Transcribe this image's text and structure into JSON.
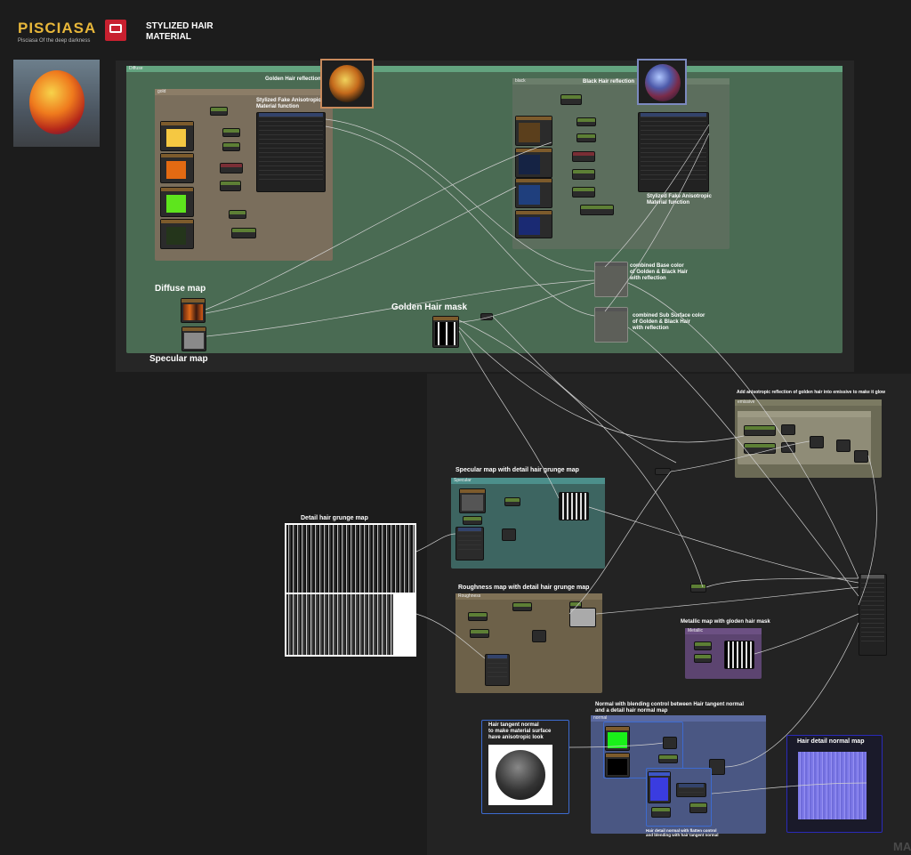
{
  "brand": {
    "logo_text": "PISCIASA",
    "tagline": "Pisciasa Of the deep darkness",
    "title_line1": "STYLIZED HAIR",
    "title_line2": "MATERIAL"
  },
  "frames": {
    "diffuse": "Diffuse",
    "golden_inner": "gold",
    "black_inner": "black",
    "specular_grunge": "Specular",
    "roughness_grunge": "Roughness",
    "metallic": "Metallic",
    "emissive": "emissive",
    "normal": "normal"
  },
  "labels": {
    "golden_reflection": "Golden Hair reflection",
    "black_reflection": "Black Hair reflection",
    "stylized_fn_1": "Stylized Fake Anisotropic",
    "stylized_fn_2": "Material function",
    "stylized_fn_b1": "Stylized Fake Anisotropic",
    "stylized_fn_b2": "Material function",
    "diffuse_map": "Diffuse map",
    "specular_map": "Specular map",
    "golden_mask": "Golden Hair mask",
    "combined_base_1": "combined Base color",
    "combined_base_2": "of Golden & Black Hair",
    "combined_base_3": "with reflection",
    "combined_sub_1": "combined Sub Surface color",
    "combined_sub_2": "of Golden & Black Hair",
    "combined_sub_3": "with reflection",
    "emissive_note": "Add anisotropic reflection of golden hair into emissive to make it glow",
    "specular_grunge": "Specular map with detail hair grunge map",
    "detail_grunge": "Detail hair grunge map",
    "roughness_grunge": "Roughness map with detail hair grunge map",
    "metallic_mask": "Metallic map with gloden hair mask",
    "normal_blend_1": "Normal with blending control between Hair tangent normal",
    "normal_blend_2": "and a detail hair normal map",
    "hair_tangent_1": "Hair tangent normal",
    "hair_tangent_2": "to make material surface",
    "hair_tangent_3": "have anisotropic look",
    "hair_detail_normal": "Hair detail normal map",
    "normal_flatten_1": "Hair detail normal with flatten control",
    "normal_flatten_2": "and blending with hair tangent normal",
    "watermark": "MA"
  },
  "colors": {
    "diffuse_frame": "#4a6b53",
    "golden_frame": "#6f6556",
    "black_frame": "#5a6d5b",
    "specular_frame": "#3d6561",
    "roughness_frame": "#6d6149",
    "metallic_frame": "#5c4470",
    "emissive_frame": "#6b6a55",
    "normal_frame": "#4a5783",
    "yellow": "#f5c842",
    "orange": "#e36a12",
    "lime": "#5ee51d",
    "bright_green": "#19f019",
    "normal_blue": "#7d79e8"
  },
  "icons": [
    "logo-icon",
    "studio-badge-icon",
    "golden-sphere-icon",
    "black-sphere-icon",
    "preview-sphere-icon",
    "tangent-sphere-icon"
  ]
}
